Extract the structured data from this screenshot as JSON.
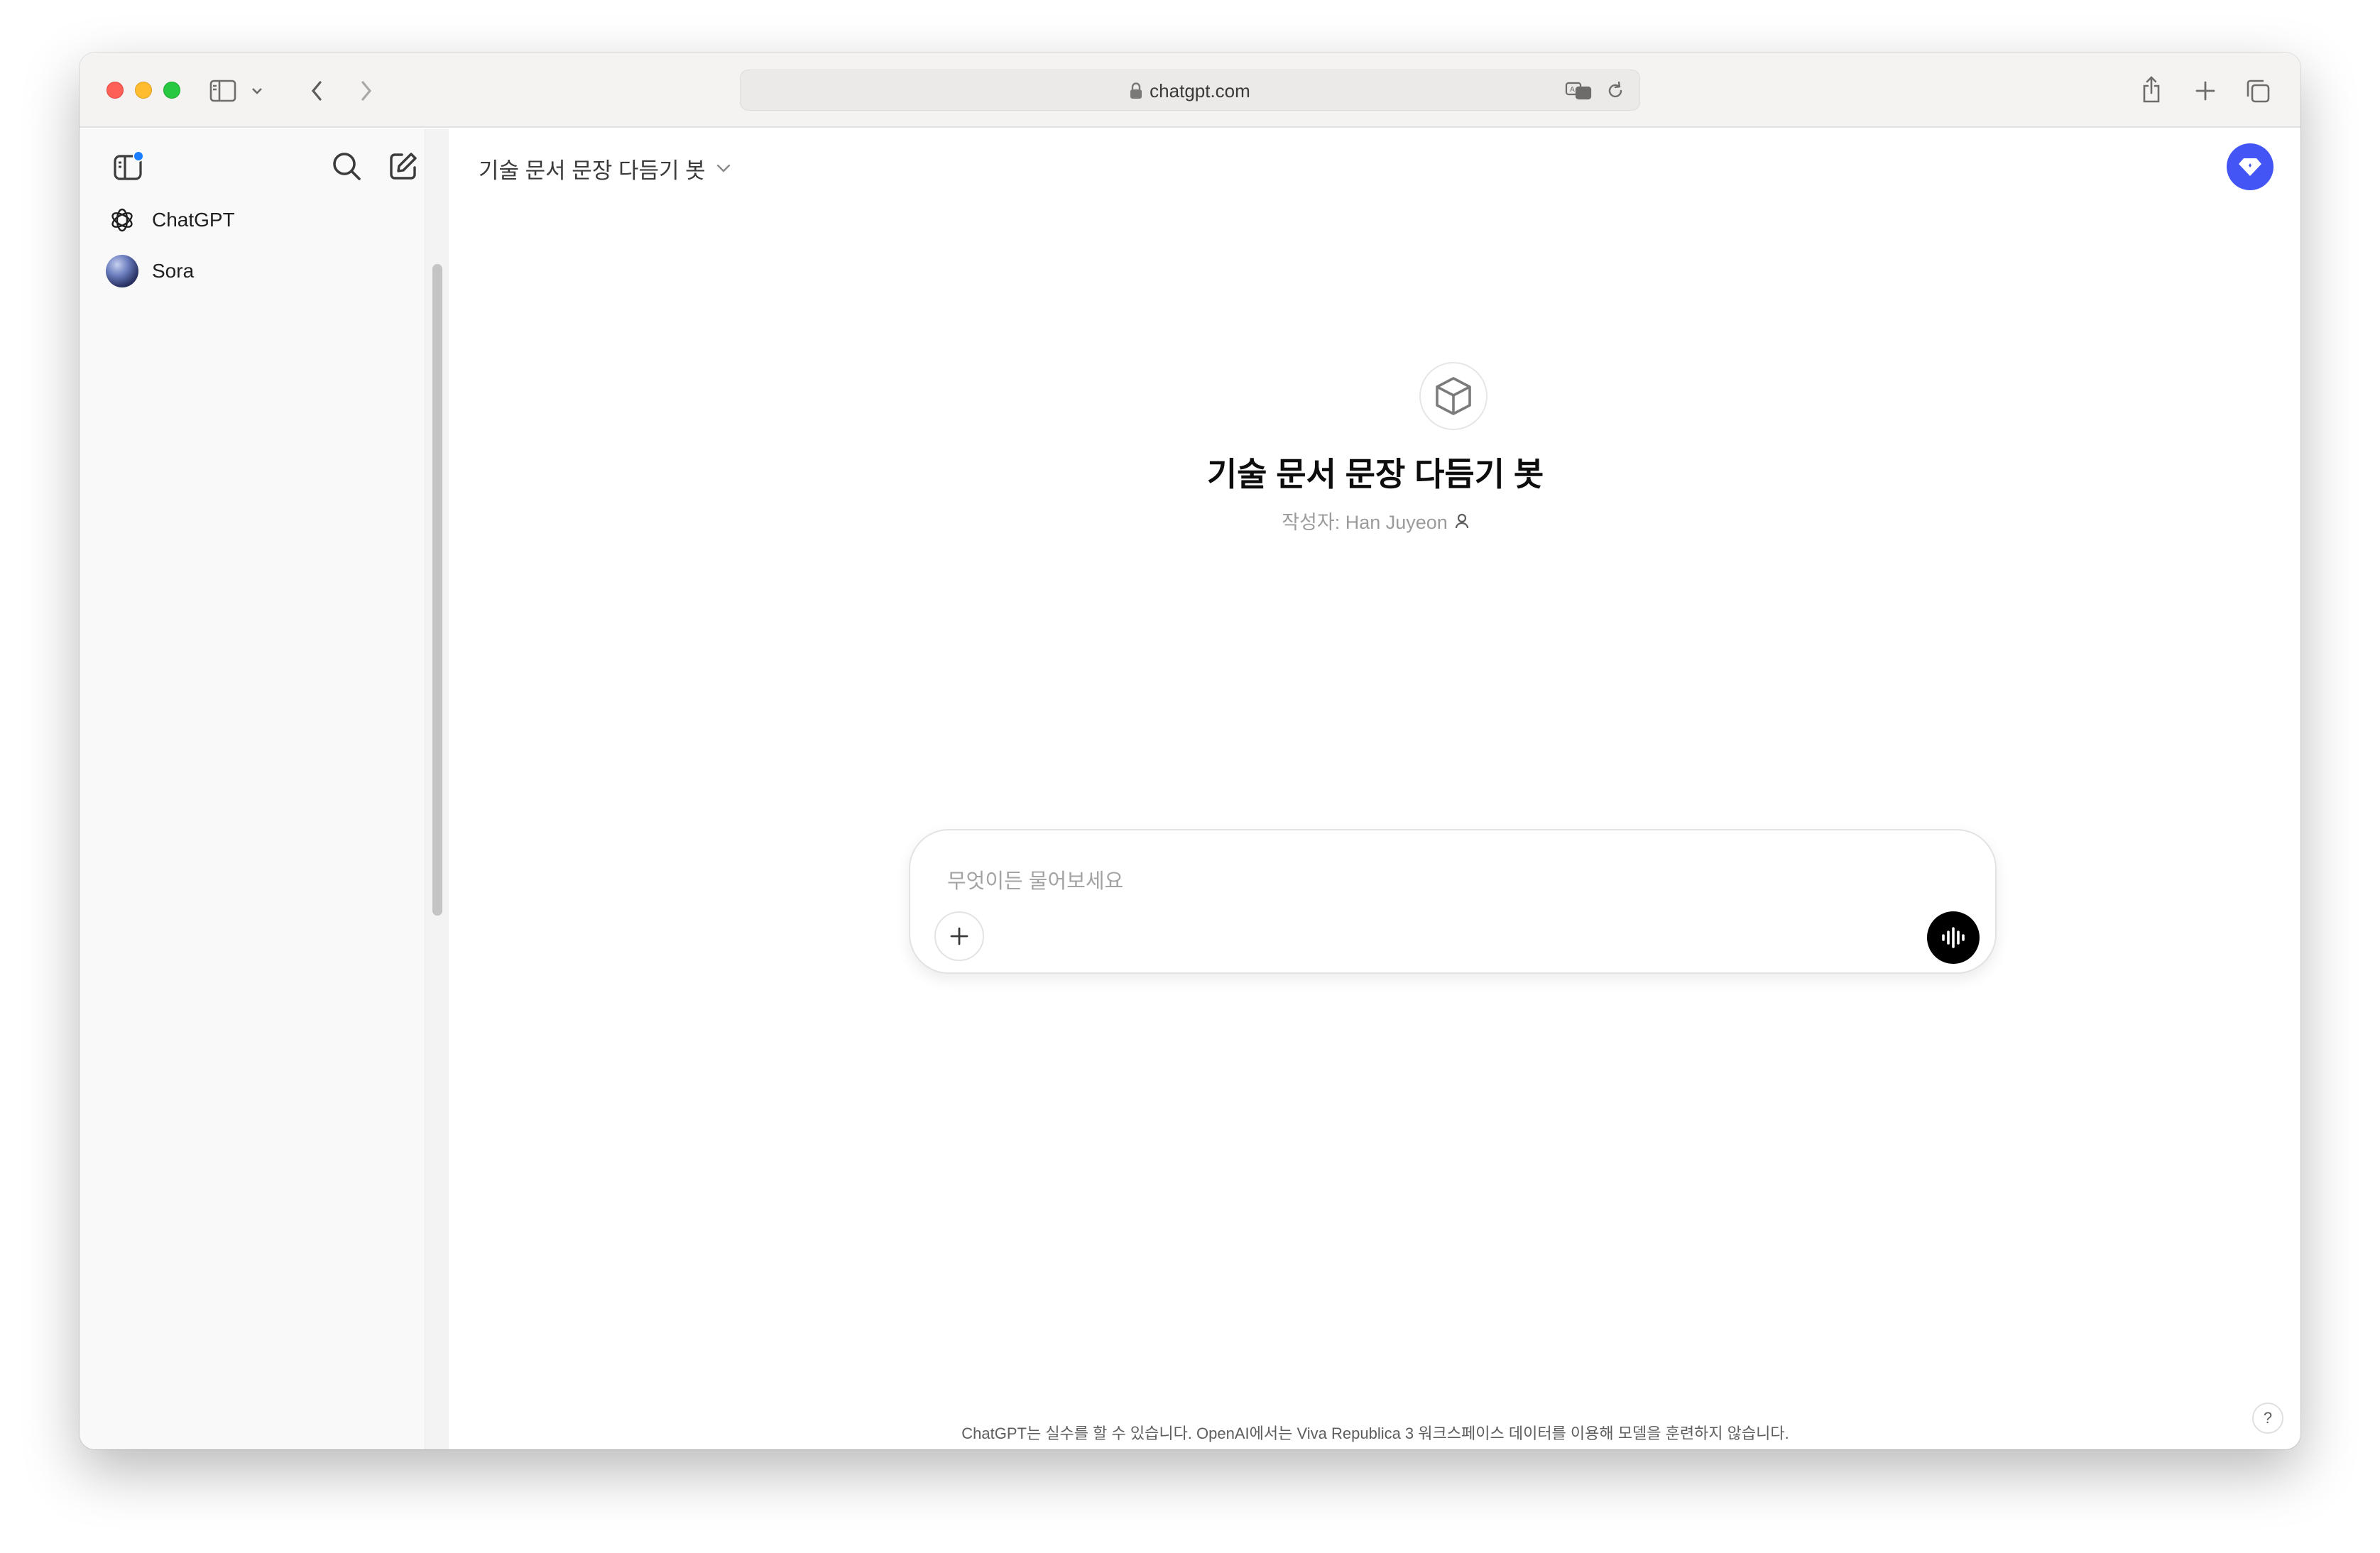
{
  "browser": {
    "url": "chatgpt.com"
  },
  "sidebar": {
    "items": [
      {
        "label": "ChatGPT",
        "icon": "openai-logo-icon"
      },
      {
        "label": "Sora",
        "icon": "sora-avatar"
      }
    ]
  },
  "header": {
    "gpt_title": "기술 문서 문장 다듬기 봇"
  },
  "gpt": {
    "name": "기술 문서 문장 다듬기 봇",
    "author": "작성자: Han Juyeon",
    "icon": "cube-icon"
  },
  "composer": {
    "placeholder": "무엇이든 물어보세요"
  },
  "footer": {
    "disclaimer": "ChatGPT는 실수를 할 수 있습니다. OpenAI에서는 Viva Republica 3 워크스페이스 데이터를 이용해 모델을 훈련하지 않습니다.",
    "help": "?"
  },
  "colors": {
    "accent": "#4355f5",
    "notification_dot": "#1a7cff"
  }
}
